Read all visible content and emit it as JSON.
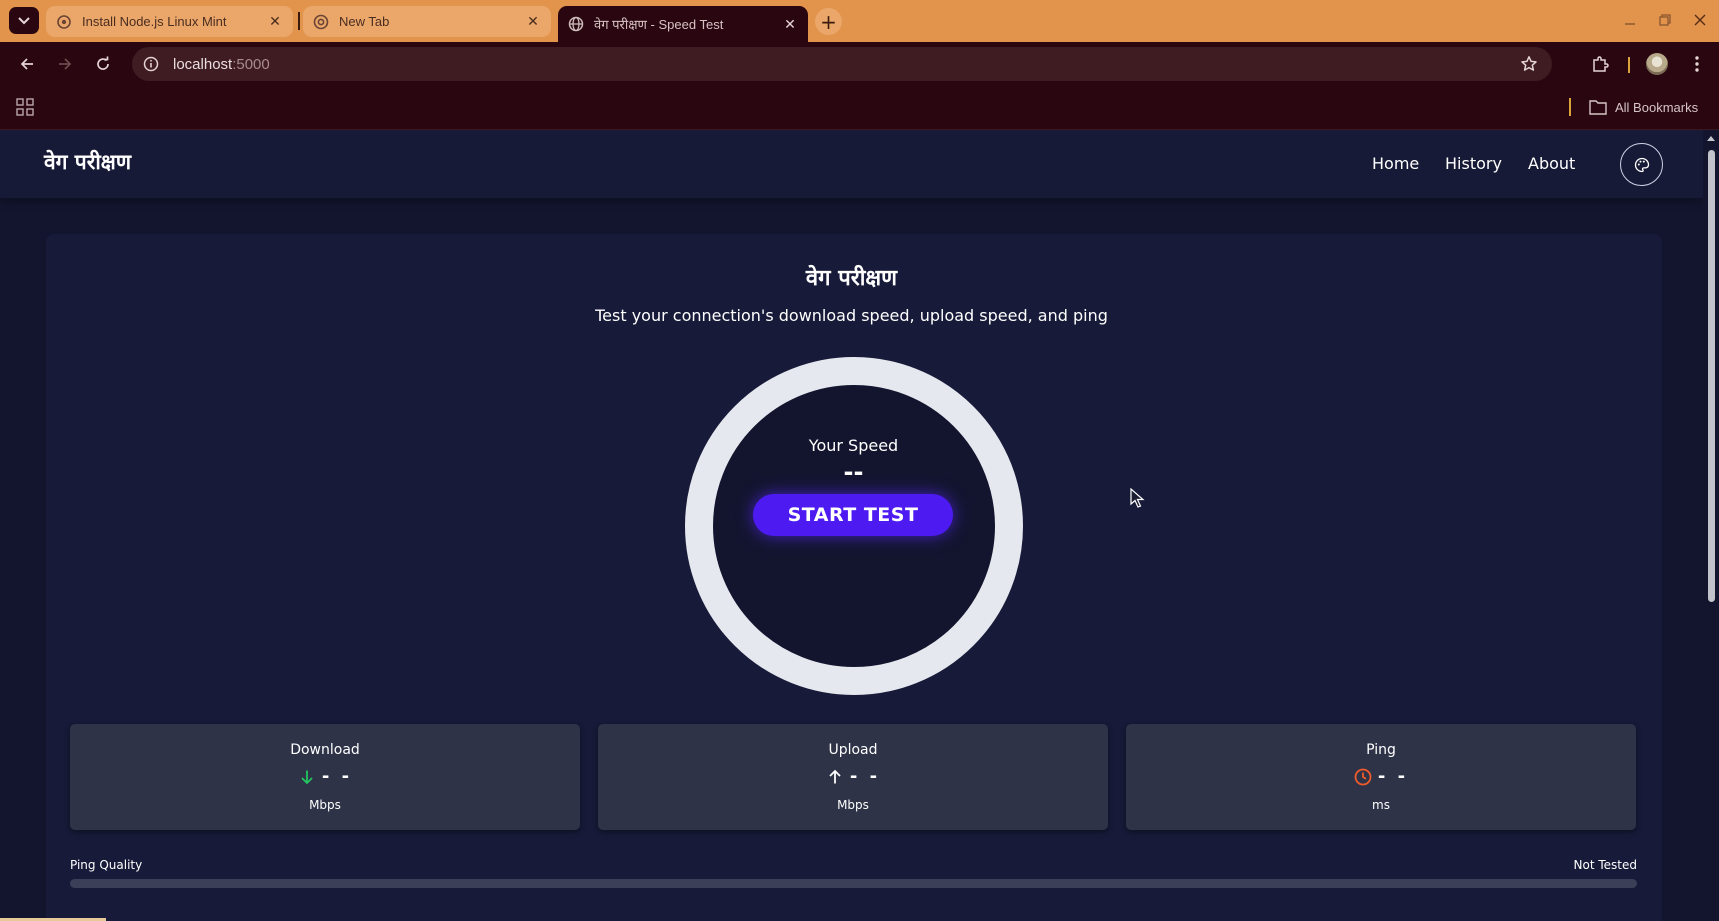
{
  "browser": {
    "tabs": [
      {
        "title": "Install Node.js Linux Mint",
        "active": false
      },
      {
        "title": "New Tab",
        "active": false
      },
      {
        "title": "वेग परीक्षण - Speed Test",
        "active": true
      }
    ],
    "url_host": "localhost",
    "url_port": ":5000",
    "all_bookmarks_label": "All Bookmarks",
    "colors": {
      "tabbar": "#e2944c",
      "toolbar": "#2a0710",
      "omnibox": "#3f1b22"
    }
  },
  "site": {
    "brand": "वेग परीक्षण",
    "nav": {
      "home": "Home",
      "history": "History",
      "about": "About"
    },
    "title": "वेग परीक्षण",
    "subtitle": "Test your connection's download speed, upload speed, and ping",
    "gauge": {
      "label": "Your Speed",
      "value": "--"
    },
    "start_button": "START TEST",
    "metrics": {
      "download": {
        "label": "Download",
        "value": "- -",
        "unit": "Mbps",
        "icon": "arrow-down-icon",
        "color": "#22c55e"
      },
      "upload": {
        "label": "Upload",
        "value": "- -",
        "unit": "Mbps",
        "icon": "arrow-up-icon",
        "color": "#ffffff"
      },
      "ping": {
        "label": "Ping",
        "value": "- -",
        "unit": "ms",
        "icon": "clock-icon",
        "color": "#ef5a2b"
      }
    },
    "ping_quality": {
      "label": "Ping Quality",
      "status": "Not Tested",
      "level": 0
    },
    "colors": {
      "background": "#13152f",
      "accent": "#4d1bf2",
      "card": "#2e3348"
    }
  }
}
